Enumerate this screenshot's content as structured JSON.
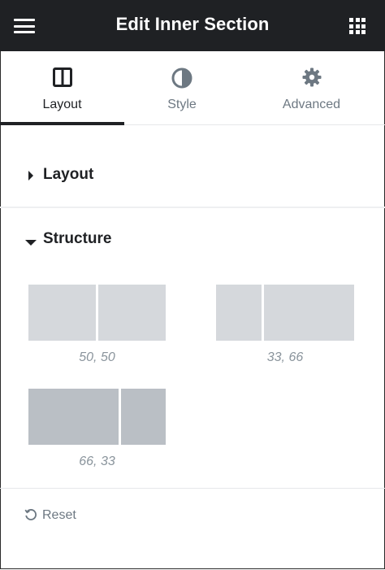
{
  "header": {
    "title": "Edit Inner Section",
    "menu_icon": "hamburger-menu-icon",
    "widgets_icon": "grid-apps-icon",
    "background": "#1f2124"
  },
  "tabs": [
    {
      "label": "Layout",
      "icon": "columns-layout-icon",
      "active": true
    },
    {
      "label": "Style",
      "icon": "half-circle-contrast-icon",
      "active": false
    },
    {
      "label": "Advanced",
      "icon": "gear-icon",
      "active": false
    }
  ],
  "sections": {
    "layout": {
      "label": "Layout",
      "expanded": false
    },
    "structure": {
      "label": "Structure",
      "expanded": true
    }
  },
  "structure_presets": [
    {
      "caption": "50, 50",
      "selected": false
    },
    {
      "caption": "33, 66",
      "selected": false
    },
    {
      "caption": "66, 33",
      "selected": true
    }
  ],
  "colors": {
    "preset_box": "#d5d8dc",
    "preset_box_selected": "#babfc5",
    "active_text": "#1f2124",
    "muted_text": "#6d7882"
  },
  "reset": {
    "label": "Reset",
    "icon": "undo-reset-icon"
  }
}
